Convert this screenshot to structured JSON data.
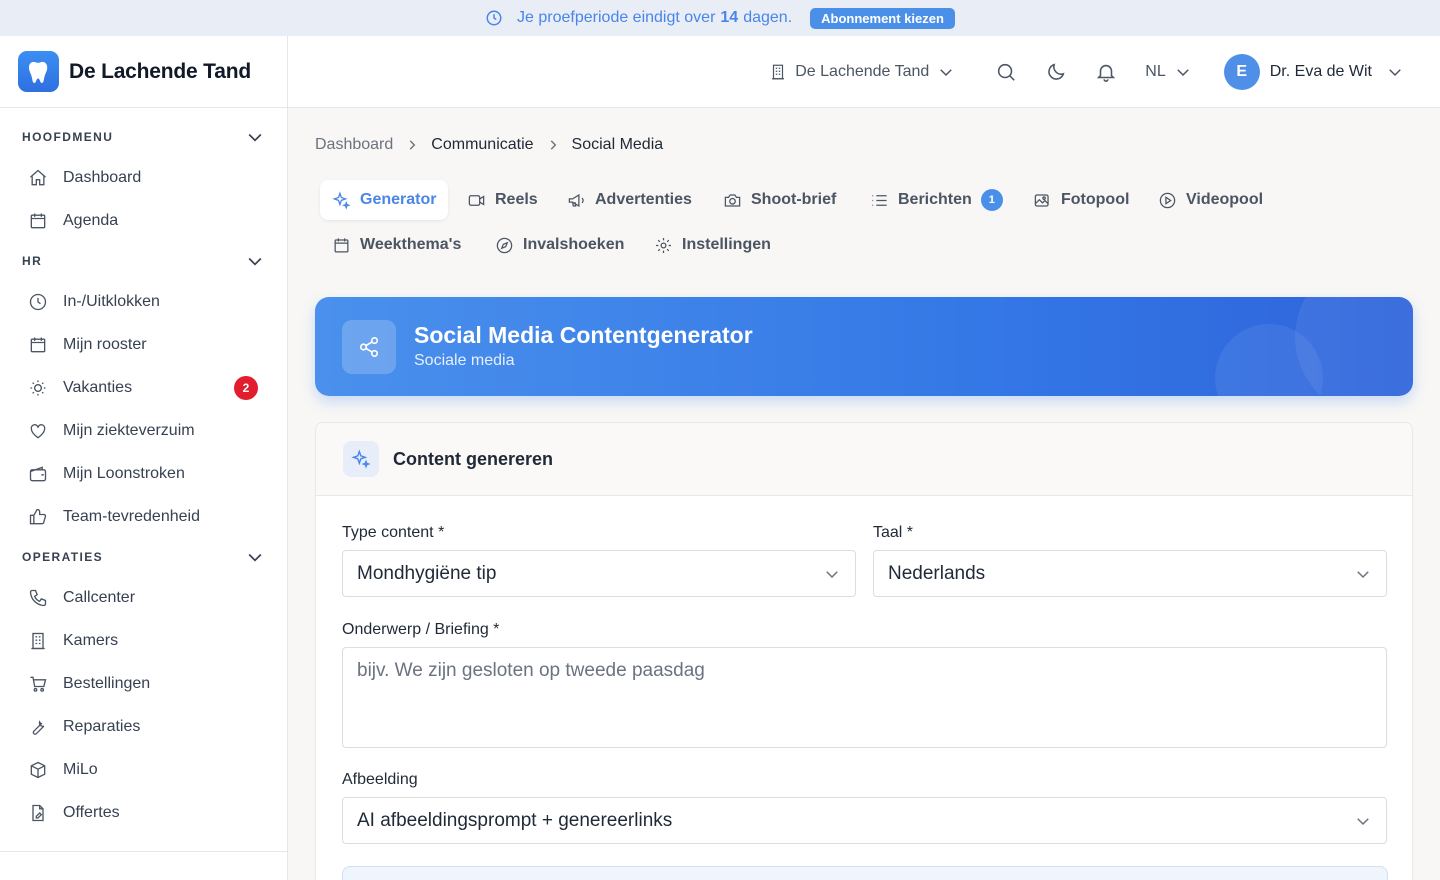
{
  "trial": {
    "prefix": "Je proefperiode eindigt over",
    "days": "14",
    "suffix": "dagen.",
    "button": "Abonnement kiezen"
  },
  "brand": {
    "name": "De Lachende Tand"
  },
  "sidebar": {
    "sections": [
      {
        "title": "HOOFDMENU",
        "items": [
          {
            "label": "Dashboard",
            "icon": "home-icon"
          },
          {
            "label": "Agenda",
            "icon": "calendar-icon"
          }
        ]
      },
      {
        "title": "HR",
        "items": [
          {
            "label": "In-/Uitklokken",
            "icon": "clock-icon"
          },
          {
            "label": "Mijn rooster",
            "icon": "calendar-icon"
          },
          {
            "label": "Vakanties",
            "icon": "sun-icon",
            "badge": "2"
          },
          {
            "label": "Mijn ziekteverzuim",
            "icon": "heart-icon"
          },
          {
            "label": "Mijn Loonstroken",
            "icon": "wallet-icon"
          },
          {
            "label": "Team-tevredenheid",
            "icon": "thumbs-up-icon"
          }
        ]
      },
      {
        "title": "OPERATIES",
        "items": [
          {
            "label": "Callcenter",
            "icon": "phone-icon"
          },
          {
            "label": "Kamers",
            "icon": "building-icon"
          },
          {
            "label": "Bestellingen",
            "icon": "cart-icon"
          },
          {
            "label": "Reparaties",
            "icon": "wrench-icon"
          },
          {
            "label": "MiLo",
            "icon": "box-icon"
          },
          {
            "label": "Offertes",
            "icon": "document-icon"
          }
        ]
      }
    ]
  },
  "topbar": {
    "practice": "De Lachende Tand",
    "language": "NL",
    "user_initial": "E",
    "user_name": "Dr. Eva de Wit"
  },
  "breadcrumb": [
    "Dashboard",
    "Communicatie",
    "Social Media"
  ],
  "tabs": [
    {
      "label": "Generator",
      "icon": "sparkles-icon",
      "active": true
    },
    {
      "label": "Reels",
      "icon": "video-icon"
    },
    {
      "label": "Advertenties",
      "icon": "megaphone-icon"
    },
    {
      "label": "Shoot-brief",
      "icon": "camera-icon"
    },
    {
      "label": "Berichten",
      "icon": "list-icon",
      "count": "1"
    },
    {
      "label": "Fotopool",
      "icon": "images-icon"
    },
    {
      "label": "Videopool",
      "icon": "play-icon"
    },
    {
      "label": "Weekthema's",
      "icon": "calendar-icon"
    },
    {
      "label": "Invalshoeken",
      "icon": "compass-icon"
    },
    {
      "label": "Instellingen",
      "icon": "gear-icon"
    }
  ],
  "hero": {
    "title": "Social Media Contentgenerator",
    "subtitle": "Sociale media"
  },
  "form": {
    "card_title": "Content genereren",
    "type_label": "Type content *",
    "type_value": "Mondhygiëne tip",
    "lang_label": "Taal *",
    "lang_value": "Nederlands",
    "topic_label": "Onderwerp / Briefing *",
    "topic_placeholder": "bijv. We zijn gesloten op tweede paasdag",
    "image_label": "Afbeelding",
    "image_value": "AI afbeeldingsprompt + genereerlinks"
  },
  "colors": {
    "accent": "#4a86e8",
    "badge": "#e11d2e"
  }
}
